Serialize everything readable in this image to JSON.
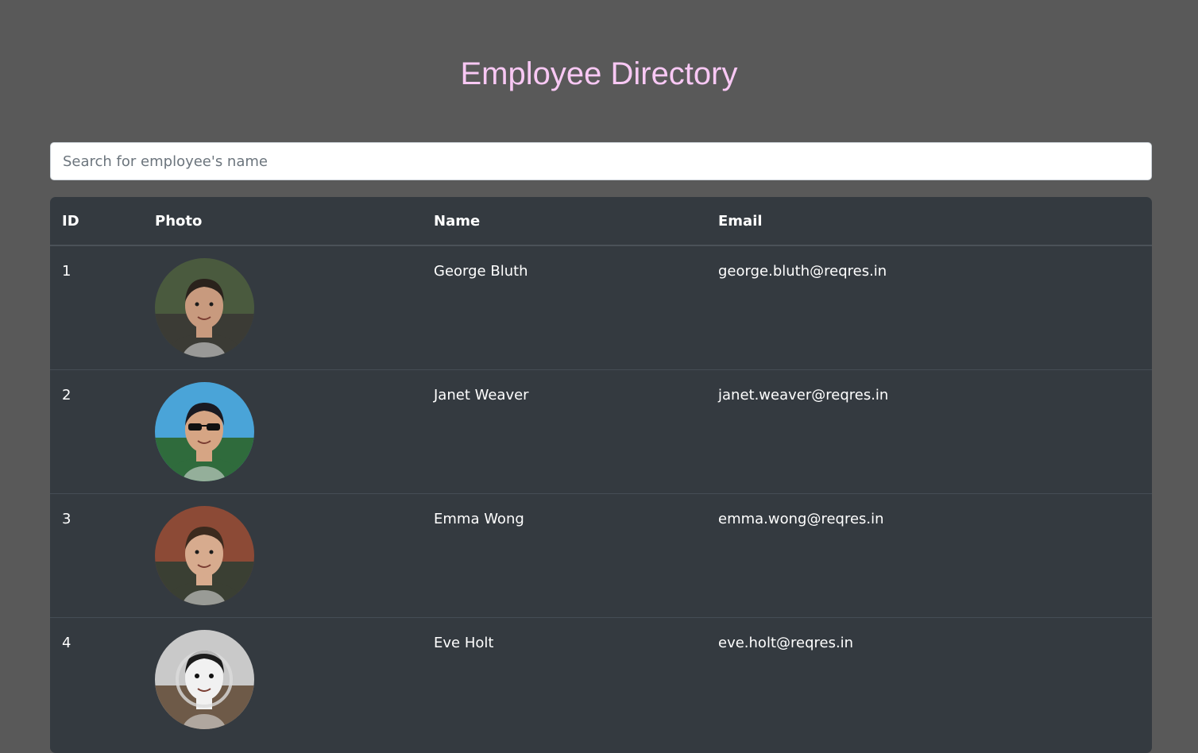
{
  "header": {
    "title": "Employee Directory"
  },
  "search": {
    "placeholder": "Search for employee's name",
    "value": ""
  },
  "table": {
    "columns": [
      "ID",
      "Photo",
      "Name",
      "Email"
    ],
    "rows": [
      {
        "id": "1",
        "name": "George Bluth",
        "email": "george.bluth@reqres.in",
        "avatar_colors": [
          "#4a5a3e",
          "#3b3b35",
          "#c89a7e",
          "#2a221c"
        ]
      },
      {
        "id": "2",
        "name": "Janet Weaver",
        "email": "janet.weaver@reqres.in",
        "avatar_colors": [
          "#4aa4d8",
          "#2f6b3c",
          "#d6a584",
          "#1a1a22"
        ]
      },
      {
        "id": "3",
        "name": "Emma Wong",
        "email": "emma.wong@reqres.in",
        "avatar_colors": [
          "#8c4a36",
          "#3a3f33",
          "#d7ab8e",
          "#3b2a1e"
        ]
      },
      {
        "id": "4",
        "name": "Eve Holt",
        "email": "eve.holt@reqres.in",
        "avatar_colors": [
          "#c9c9c9",
          "#6e5a48",
          "#f1f1f1",
          "#1b1b1b"
        ]
      }
    ]
  },
  "colors": {
    "page_background": "#595959",
    "title_color": "#f8c8f4",
    "table_background": "#343a40"
  }
}
